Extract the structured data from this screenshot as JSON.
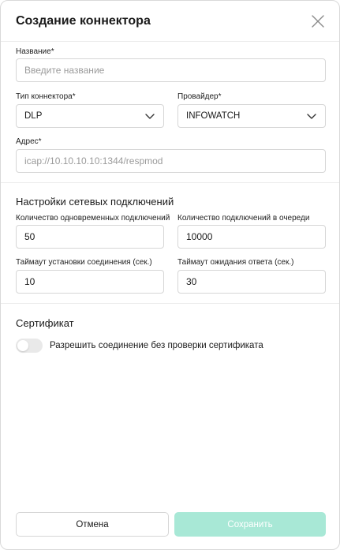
{
  "dialog": {
    "title": "Создание коннектора",
    "close_icon": "close-icon"
  },
  "form": {
    "name": {
      "label": "Название*",
      "placeholder": "Введите название",
      "value": ""
    },
    "connector_type": {
      "label": "Тип коннектора*",
      "value": "DLP"
    },
    "provider": {
      "label": "Провайдер*",
      "value": "INFOWATCH"
    },
    "address": {
      "label": "Адрес*",
      "placeholder": "icap://10.10.10.10:1344/respmod",
      "value": ""
    }
  },
  "network": {
    "title": "Настройки сетевых подключений",
    "concurrent": {
      "label": "Количество одновременных подключений",
      "value": "50"
    },
    "queue": {
      "label": "Количество подключений в очереди",
      "value": "10000"
    },
    "connect_timeout": {
      "label": "Таймаут установки соединения (сек.)",
      "value": "10"
    },
    "response_timeout": {
      "label": "Таймаут ожидания ответа (сек.)",
      "value": "30"
    }
  },
  "certificate": {
    "title": "Сертификат",
    "toggle_label": "Разрешить соединение без проверки сертификата",
    "toggle_on": false
  },
  "footer": {
    "cancel_label": "Отмена",
    "save_label": "Сохранить"
  },
  "colors": {
    "save_button_bg": "#a8e8d6",
    "border": "#d6d6d6",
    "toggle_off": "#e9e9e9"
  }
}
